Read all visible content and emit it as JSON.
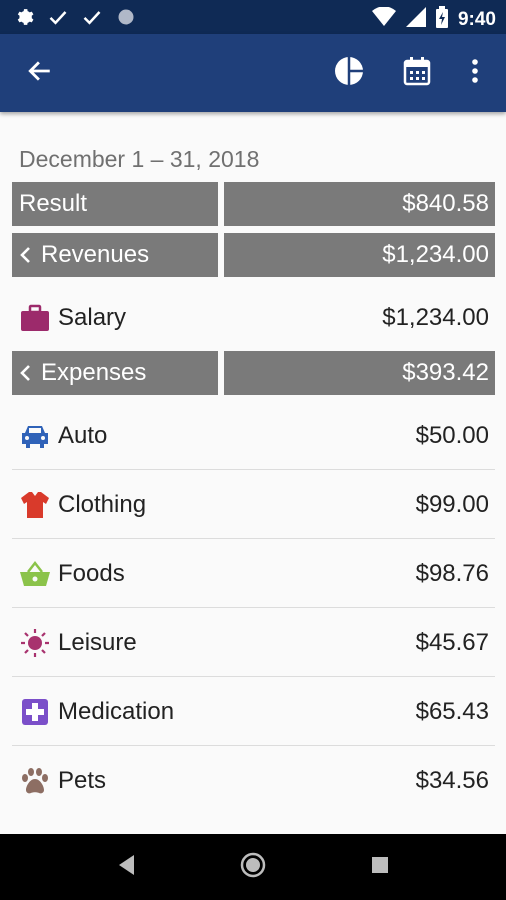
{
  "status_bar": {
    "time": "9:40",
    "icons": [
      "settings-icon",
      "check-icon",
      "check-icon",
      "circle-icon",
      "wifi-icon",
      "signal-icon",
      "battery-icon"
    ]
  },
  "app_bar": {
    "icons": [
      "back-arrow-icon",
      "pie-chart-icon",
      "calendar-icon",
      "more-vert-icon"
    ],
    "color": "#1f3f7a"
  },
  "period": {
    "label": "December 1 – 31, 2018"
  },
  "result": {
    "label": "Result",
    "amount": "$840.58"
  },
  "revenues": {
    "label": "Revenues",
    "amount": "$1,234.00",
    "items": [
      {
        "name": "Salary",
        "amount": "$1,234.00",
        "icon": "briefcase-icon",
        "color": "#9c2a6b"
      }
    ]
  },
  "expenses": {
    "label": "Expenses",
    "amount": "$393.42",
    "items": [
      {
        "name": "Auto",
        "amount": "$50.00",
        "icon": "car-icon",
        "color": "#2f62b8"
      },
      {
        "name": "Clothing",
        "amount": "$99.00",
        "icon": "shirt-icon",
        "color": "#d93a2b"
      },
      {
        "name": "Foods",
        "amount": "$98.76",
        "icon": "basket-icon",
        "color": "#8bc34a"
      },
      {
        "name": "Leisure",
        "amount": "$45.67",
        "icon": "sun-icon",
        "color": "#a8326e"
      },
      {
        "name": "Medication",
        "amount": "$65.43",
        "icon": "medical-cross-icon",
        "color": "#7b4fc9"
      },
      {
        "name": "Pets",
        "amount": "$34.56",
        "icon": "paw-icon",
        "color": "#8d6e63"
      }
    ]
  },
  "summary_box_color": "#7a7a7a",
  "nav_bar": {
    "icons": [
      "back-triangle-icon",
      "home-circle-icon",
      "recents-square-icon"
    ]
  }
}
